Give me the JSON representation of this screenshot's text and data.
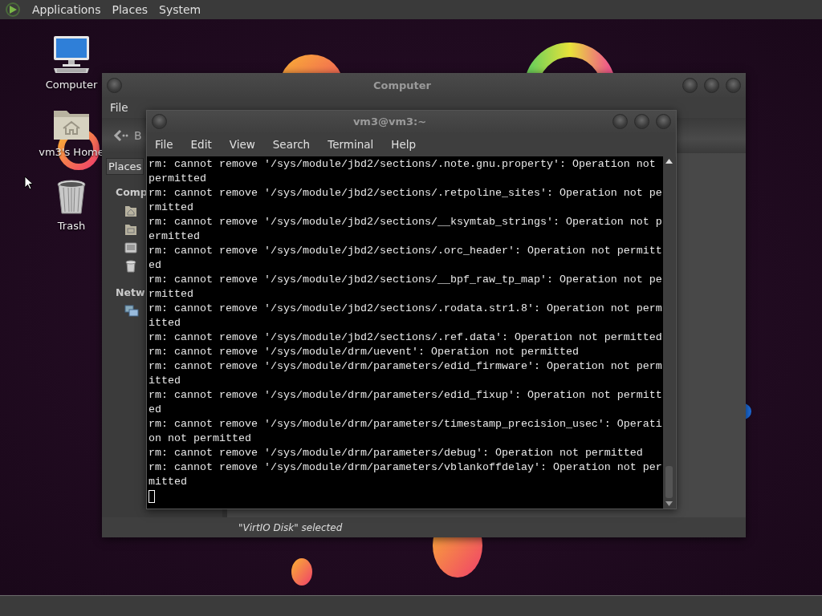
{
  "top_panel": {
    "menus": [
      "Applications",
      "Places",
      "System"
    ]
  },
  "desktop_icons": [
    {
      "label": "Computer",
      "kind": "computer"
    },
    {
      "label": "vm3's Home",
      "kind": "home"
    },
    {
      "label": "Trash",
      "kind": "trash"
    }
  ],
  "file_manager": {
    "title": "Computer",
    "menus": [
      "File"
    ],
    "back_button": "B",
    "sidebar": {
      "selector": "Places",
      "sections": [
        {
          "heading": "Comp",
          "items": [
            {
              "kind": "home"
            },
            {
              "kind": "desktop"
            },
            {
              "kind": "filesystem"
            },
            {
              "kind": "trash"
            }
          ]
        },
        {
          "heading": "Netw",
          "items": [
            {
              "kind": "network"
            }
          ]
        }
      ]
    },
    "status_bar": "\"VirtIO Disk\" selected"
  },
  "terminal": {
    "title": "vm3@vm3:~",
    "menus": [
      "File",
      "Edit",
      "View",
      "Search",
      "Terminal",
      "Help"
    ],
    "lines": [
      "rm: cannot remove '/sys/module/jbd2/sections/.note.gnu.property': Operation not",
      "permitted",
      "rm: cannot remove '/sys/module/jbd2/sections/.retpoline_sites': Operation not pe",
      "rmitted",
      "rm: cannot remove '/sys/module/jbd2/sections/__ksymtab_strings': Operation not p",
      "ermitted",
      "rm: cannot remove '/sys/module/jbd2/sections/.orc_header': Operation not permitt",
      "ed",
      "rm: cannot remove '/sys/module/jbd2/sections/__bpf_raw_tp_map': Operation not pe",
      "rmitted",
      "rm: cannot remove '/sys/module/jbd2/sections/.rodata.str1.8': Operation not perm",
      "itted",
      "rm: cannot remove '/sys/module/jbd2/sections/.ref.data': Operation not permitted",
      "rm: cannot remove '/sys/module/drm/uevent': Operation not permitted",
      "rm: cannot remove '/sys/module/drm/parameters/edid_firmware': Operation not perm",
      "itted",
      "rm: cannot remove '/sys/module/drm/parameters/edid_fixup': Operation not permitt",
      "ed",
      "rm: cannot remove '/sys/module/drm/parameters/timestamp_precision_usec': Operati",
      "on not permitted",
      "rm: cannot remove '/sys/module/drm/parameters/debug': Operation not permitted",
      "rm: cannot remove '/sys/module/drm/parameters/vblankoffdelay': Operation not per",
      "mitted"
    ]
  }
}
